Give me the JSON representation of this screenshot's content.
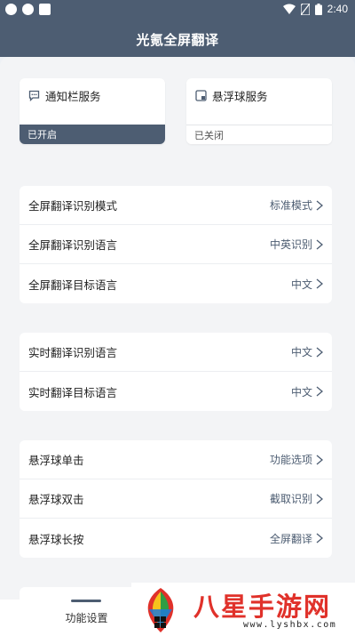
{
  "status_bar": {
    "time": "2:40"
  },
  "app_title": "光氪全屏翻译",
  "services": [
    {
      "title": "通知栏服务",
      "status": "已开启"
    },
    {
      "title": "悬浮球服务",
      "status": "已关闭"
    }
  ],
  "groups": [
    [
      {
        "label": "全屏翻译识别模式",
        "value": "标准模式"
      },
      {
        "label": "全屏翻译识别语言",
        "value": "中英识别"
      },
      {
        "label": "全屏翻译目标语言",
        "value": "中文"
      }
    ],
    [
      {
        "label": "实时翻译识别语言",
        "value": "中文"
      },
      {
        "label": "实时翻译目标语言",
        "value": "中文"
      }
    ],
    [
      {
        "label": "悬浮球单击",
        "value": "功能选项"
      },
      {
        "label": "悬浮球双击",
        "value": "截取识别"
      },
      {
        "label": "悬浮球长按",
        "value": "全屏翻译"
      }
    ]
  ],
  "tab_bar": {
    "active_tab": "功能设置"
  },
  "watermark": {
    "brand": "八星手游网",
    "url": "www.lyshbx.com"
  },
  "colors": {
    "primary": "#4d5d72",
    "background": "#f3f4f6"
  }
}
